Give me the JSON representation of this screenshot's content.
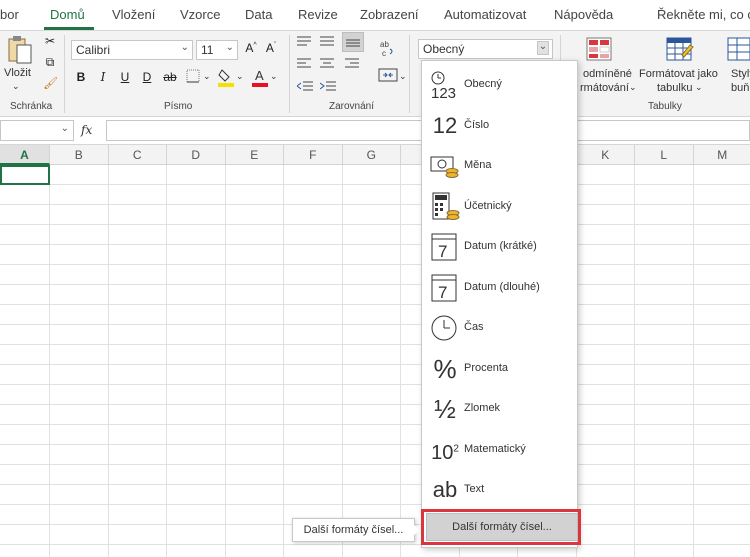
{
  "tabs": [
    "bor",
    "Domů",
    "Vložení",
    "Vzorce",
    "Data",
    "Revize",
    "Zobrazení",
    "Automatizovat",
    "Nápověda",
    "Řekněte mi, co ch"
  ],
  "active_tab": "Domů",
  "accent_color": "#217346",
  "highlight_color": "#d9363e",
  "ribbon": {
    "clipboard": {
      "paste_label": "Vložit",
      "group_label": "Schránka"
    },
    "font": {
      "font_name": "Calibri",
      "font_size": "11",
      "bold": "B",
      "italic": "I",
      "underline": "U",
      "double_underline": "D",
      "strikethrough": "ab",
      "group_label": "Písmo"
    },
    "alignment": {
      "group_label": "Zarovnání"
    },
    "number": {
      "format": "Obecný"
    },
    "styles": {
      "conditional_line1": "odmíněné",
      "conditional_line2": "rmátování",
      "format_table_line1": "Formátovat jako",
      "format_table_line2": "tabulku",
      "cell_styles_line1": "Styly",
      "cell_styles_line2": "buňky",
      "group_label": "Tabulky"
    }
  },
  "formula_bar": {
    "fx": "fx"
  },
  "columns": [
    "A",
    "B",
    "C",
    "D",
    "E",
    "F",
    "G",
    "H",
    "I",
    "J",
    "K",
    "L",
    "M"
  ],
  "active_column": "A",
  "number_formats": [
    {
      "icon_text": "123",
      "label": "Obecný"
    },
    {
      "icon_text": "12",
      "label": "Číslo"
    },
    {
      "icon_text": "",
      "label": "Měna"
    },
    {
      "icon_text": "",
      "label": "Účetnický"
    },
    {
      "icon_text": "7",
      "label": "Datum (krátké)"
    },
    {
      "icon_text": "7",
      "label": "Datum (dlouhé)"
    },
    {
      "icon_text": "",
      "label": "Čas"
    },
    {
      "icon_text": "%",
      "label": "Procenta"
    },
    {
      "icon_text": "½",
      "label": "Zlomek"
    },
    {
      "icon_text": "10",
      "icon_sup": "2",
      "label": "Matematický"
    },
    {
      "icon_text": "ab",
      "label": "Text"
    }
  ],
  "more_formats_label": "Další formáty čísel...",
  "tooltip_label": "Další formáty čísel..."
}
